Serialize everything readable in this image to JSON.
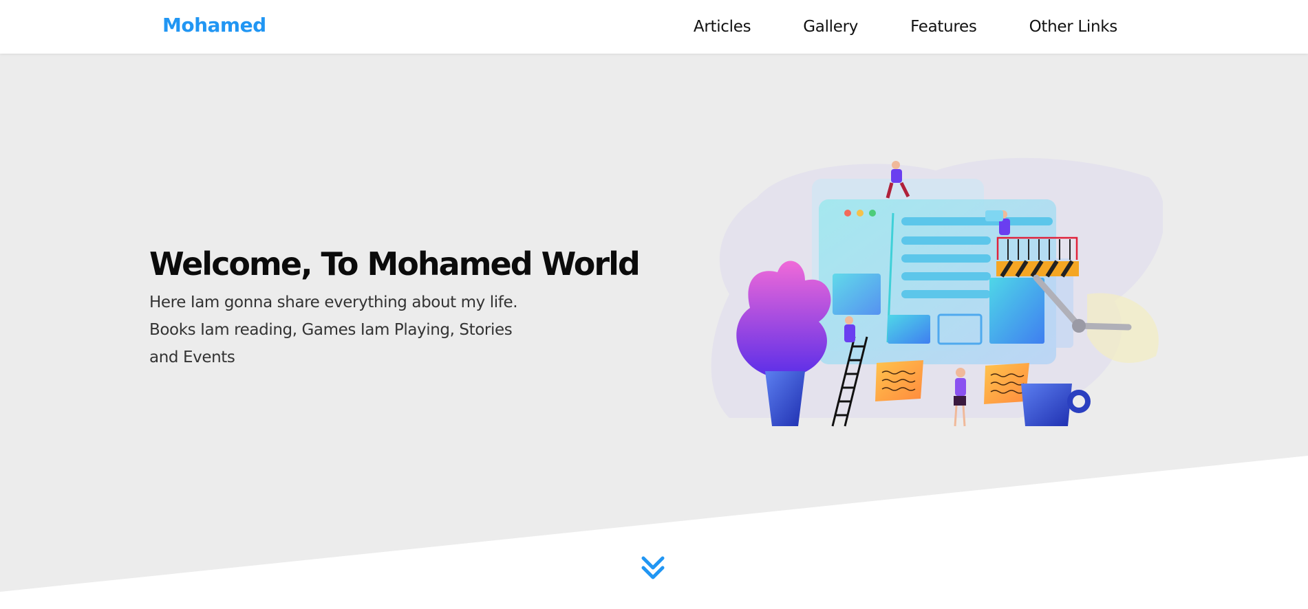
{
  "header": {
    "logo": "Mohamed",
    "nav": [
      "Articles",
      "Gallery",
      "Features",
      "Other Links"
    ]
  },
  "hero": {
    "title": "Welcome, To Mohamed World",
    "description": "Here Iam gonna share everything about my life. Books Iam reading, Games Iam Playing, Stories and Events"
  },
  "colors": {
    "accent": "#2196f3",
    "hero_background": "#ececec",
    "text_dark": "#0b0b0b",
    "text_body": "#333333"
  },
  "icons": {
    "scroll": "double-chevron-down-icon"
  }
}
